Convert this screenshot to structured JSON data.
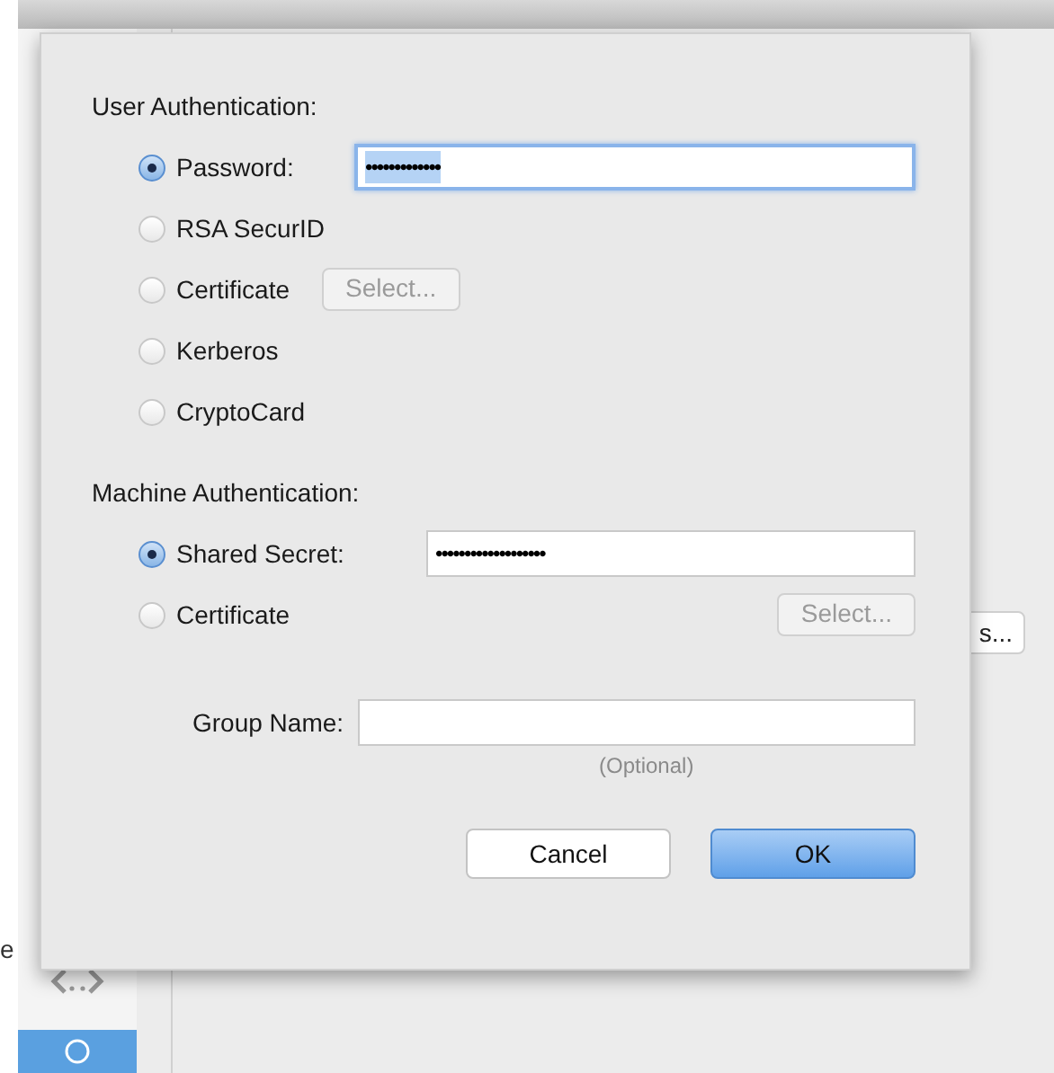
{
  "background": {
    "sidebar_label": "e",
    "button": "s..."
  },
  "user_auth": {
    "label": "User Authentication:",
    "options": [
      {
        "kind": "field",
        "label": "Password:",
        "selected": true,
        "value": "•••••••••••••",
        "focused": true
      },
      {
        "kind": "plain",
        "label": "RSA SecurID",
        "selected": false
      },
      {
        "kind": "inline-button",
        "label": "Certificate",
        "selected": false,
        "button": "Select...",
        "disabled": true
      },
      {
        "kind": "plain",
        "label": "Kerberos",
        "selected": false
      },
      {
        "kind": "plain",
        "label": "CryptoCard",
        "selected": false
      }
    ]
  },
  "machine_auth": {
    "label": "Machine Authentication:",
    "options": [
      {
        "kind": "field",
        "label": "Shared Secret:",
        "selected": true,
        "value": "•••••••••••••••••••",
        "focused": false
      },
      {
        "kind": "end-button",
        "label": "Certificate",
        "selected": false,
        "button": "Select...",
        "disabled": true
      }
    ]
  },
  "group_name": {
    "label": "Group Name:",
    "hint": "(Optional)"
  },
  "buttons": [
    {
      "label": "Cancel",
      "default": false
    },
    {
      "label": "OK",
      "default": true
    }
  ]
}
